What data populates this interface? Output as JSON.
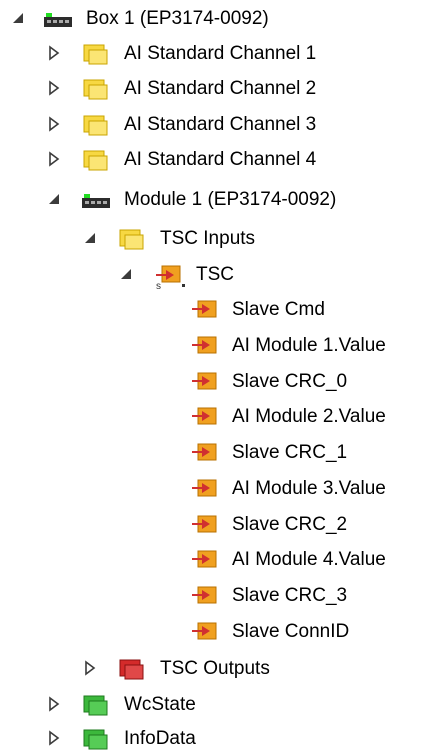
{
  "tree": {
    "nodes": [
      {
        "label": "Box 1 (EP3174-0092)",
        "icon": "ethercat-box-icon",
        "toggle": "expanded"
      },
      {
        "label": "AI Standard Channel 1",
        "icon": "yellow-folder-icon",
        "toggle": "collapsed"
      },
      {
        "label": "AI Standard Channel 2",
        "icon": "yellow-folder-icon",
        "toggle": "collapsed"
      },
      {
        "label": "AI Standard Channel 3",
        "icon": "yellow-folder-icon",
        "toggle": "collapsed"
      },
      {
        "label": "AI Standard Channel 4",
        "icon": "yellow-folder-icon",
        "toggle": "collapsed"
      },
      {
        "label": "Module 1 (EP3174-0092)",
        "icon": "ethercat-box-icon",
        "toggle": "expanded"
      },
      {
        "label": "TSC Inputs",
        "icon": "yellow-folder-icon",
        "toggle": "expanded"
      },
      {
        "label": "TSC",
        "icon": "input-variable-linked-icon",
        "toggle": "expanded"
      },
      {
        "label": "Slave Cmd",
        "icon": "input-variable-icon",
        "toggle": "none"
      },
      {
        "label": "AI Module 1.Value",
        "icon": "input-variable-icon",
        "toggle": "none"
      },
      {
        "label": "Slave CRC_0",
        "icon": "input-variable-icon",
        "toggle": "none"
      },
      {
        "label": "AI Module 2.Value",
        "icon": "input-variable-icon",
        "toggle": "none"
      },
      {
        "label": "Slave CRC_1",
        "icon": "input-variable-icon",
        "toggle": "none"
      },
      {
        "label": "AI Module 3.Value",
        "icon": "input-variable-icon",
        "toggle": "none"
      },
      {
        "label": "Slave CRC_2",
        "icon": "input-variable-icon",
        "toggle": "none"
      },
      {
        "label": "AI Module 4.Value",
        "icon": "input-variable-icon",
        "toggle": "none"
      },
      {
        "label": "Slave CRC_3",
        "icon": "input-variable-icon",
        "toggle": "none"
      },
      {
        "label": "Slave ConnID",
        "icon": "input-variable-icon",
        "toggle": "none"
      },
      {
        "label": "TSC Outputs",
        "icon": "red-folder-icon",
        "toggle": "collapsed"
      },
      {
        "label": "WcState",
        "icon": "green-folder-icon",
        "toggle": "collapsed"
      },
      {
        "label": "InfoData",
        "icon": "green-folder-icon",
        "toggle": "collapsed"
      }
    ]
  },
  "colors": {
    "folder_yellow": "#f7d842",
    "folder_red": "#d42a2a",
    "folder_green": "#3cb83c",
    "box_green": "#22dd22",
    "variable_orange": "#f0a020",
    "variable_red_arrow": "#d03030"
  }
}
